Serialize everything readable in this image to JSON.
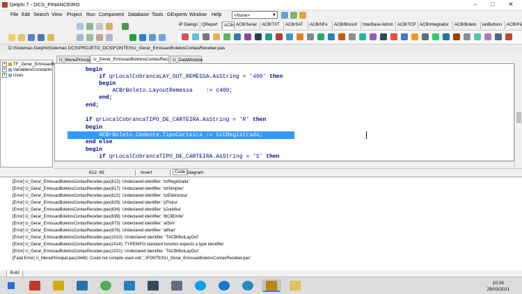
{
  "window": {
    "title": "Delphi 7 - DCS_FINANCEIRO"
  },
  "menu": [
    "File",
    "Edit",
    "Search",
    "View",
    "Project",
    "Run",
    "Component",
    "Database",
    "Tools",
    "GExperts",
    "Window",
    "Help"
  ],
  "desktop_combo": {
    "value": "<None>"
  },
  "palette_tabs": [
    "IP Dialogs",
    "QReport",
    "ACBr",
    "ACBrSerial",
    "ACBrTXT",
    "ACBrSAT",
    "ACBrNFe",
    "ACBrBlocoX",
    "InterBase Admin",
    "ACBrTCP",
    "ACBrIntegrador",
    "ACBrBoleto",
    "ianButtons",
    "ACBrPau"
  ],
  "path": "D:\\Sistemas Delphi\\Sistemas DCS\\PROJETO_DCS\\FONTES\\U_Gerar_EmissaoBoletosContasReceber.pas",
  "editor_tabs": [
    "U_MenuPrincipal",
    "U_Gerar_EmissaoBoletosContasReceber",
    "U_DataModule"
  ],
  "tree": [
    "TF_Gerar_EmissaoB",
    "Variables/Constants",
    "Uses"
  ],
  "code": [
    [
      "begin"
    ],
    [
      "    if qrLocalCobrancaLAY_OUT_REMESSA.AsString = '400' then"
    ],
    [
      "    begin"
    ],
    [
      "        ACBrBoleto.LayoutRemessa    := c400;"
    ],
    [
      "    end;"
    ],
    [
      "end;"
    ],
    [
      ""
    ],
    [
      "if qrLocalCobrancaTIPO_DE_CARTEIRA.AsString = 'R' then"
    ],
    [
      "begin"
    ],
    [
      "    ACBrBoleto.Cedente.TipoCarteira := tctRegistrada;"
    ],
    [
      "end else"
    ],
    [
      "begin"
    ],
    [
      "    if qrLocalCobrancaTIPO_DE_CARTEIRA.AsString = 'S' then"
    ]
  ],
  "status": {
    "position": "612:  65",
    "mode": "Insert",
    "tab_code": "Code",
    "tab_diagram": "Diagram"
  },
  "messages": [
    "[Error] U_Gerar_EmissaoBoletosContasReceber.pas(612): Undeclared identifier: 'tctRegistrada'",
    "[Error] U_Gerar_EmissaoBoletosContasReceber.pas(617): Undeclared identifier: 'tctSimples'",
    "[Error] U_Gerar_EmissaoBoletosContasReceber.pas(622): Undeclared identifier: 'tctEletronica'",
    "[Error] U_Gerar_EmissaoBoletosContasReceber.pas(629): Undeclared identifier: 'pFisica'",
    "[Error] U_Gerar_EmissaoBoletosContasReceber.pas(634): Undeclared identifier: 'pJuridica'",
    "[Error] U_Gerar_EmissaoBoletosContasReceber.pas(639): Undeclared identifier: 'tbCliEmite'",
    "[Error] U_Gerar_EmissaoBoletosContasReceber.pas(673): Undeclared identifier: 'atSim'",
    "[Error] U_Gerar_EmissaoBoletosContasReceber.pas(676): Undeclared identifier: 'atNao'",
    "[Error] U_Gerar_EmissaoBoletosContasReceber.pas(1010): Undeclared identifier: 'TACBrBolLayOut'",
    "[Error] U_Gerar_EmissaoBoletosContasReceber.pas(1014): TYPEINFO standard function expects a type identifier",
    "[Error] U_Gerar_EmissaoBoletosContasReceber.pas(1021): Undeclared identifier: 'TACBrBolLayOut'",
    "[Fatal Error] U_MenuPrincipal.pas(1648): Could not compile used unit '..\\FONTES\\U_Gerar_EmissaoBoletosContasReceber.pas'"
  ],
  "build_tab": "Build",
  "clock": {
    "time": "10:26",
    "date": "29/03/2021"
  },
  "taskbar_icons": [
    "start-icon",
    "search-icon",
    "task-view-icon",
    "file-explorer-icon",
    "chrome-icon",
    "app-icon",
    "app-icon",
    "skype-icon",
    "edge-icon",
    "media-player-icon",
    "delphi-icon",
    "files-icon"
  ],
  "colors": {
    "selection": "#3399ff",
    "keyword": "#000080",
    "string": "#0000ff"
  }
}
